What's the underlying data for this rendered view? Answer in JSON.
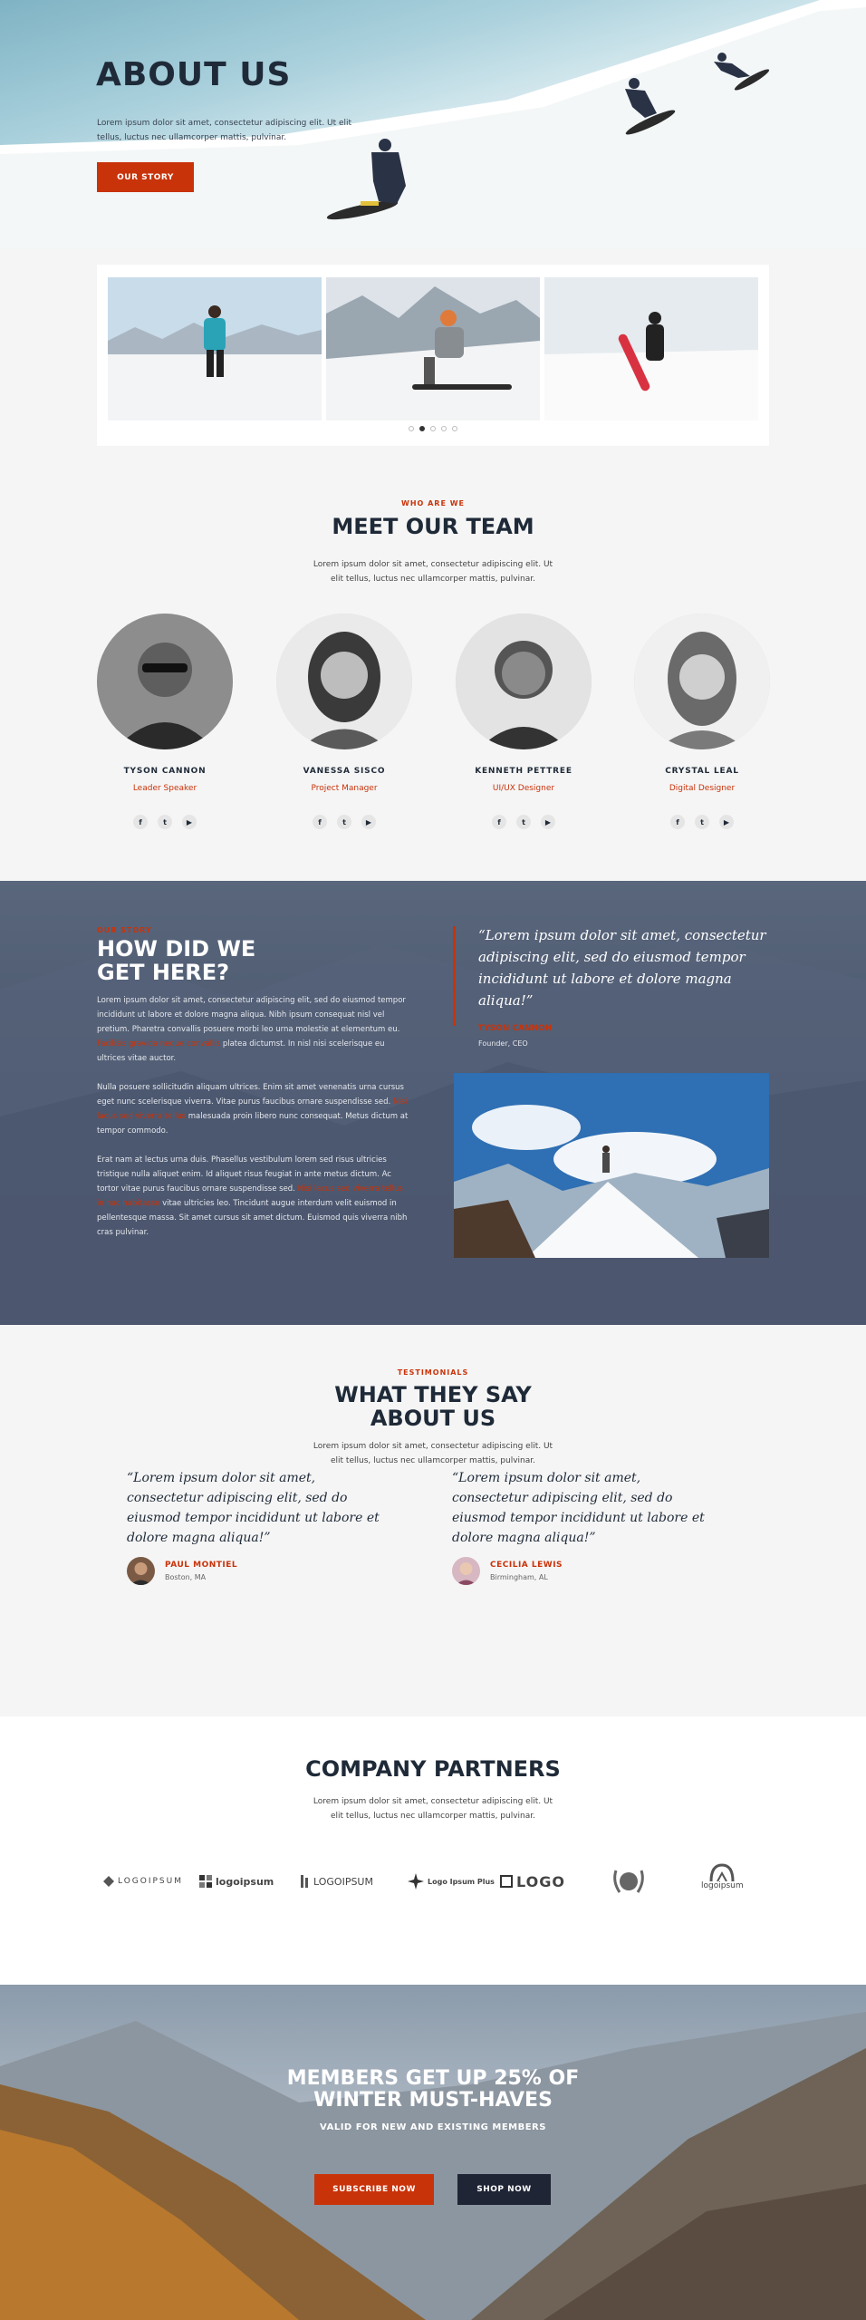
{
  "hero": {
    "title": "ABOUT US",
    "text": "Lorem ipsum dolor sit amet, consectetur adipiscing elit. Ut elit tellus, luctus nec ullamcorper mattis, pulvinar.",
    "button": "OUR STORY"
  },
  "carousel": {
    "slides": [
      "hiker-on-snow",
      "snowboarder-sitting",
      "snowboarder-with-board"
    ],
    "dots": 5,
    "active_dot": 2
  },
  "team": {
    "eyebrow": "WHO ARE WE",
    "title": "MEET OUR TEAM",
    "text": "Lorem ipsum dolor sit amet, consectetur adipiscing elit. Ut elit tellus, luctus nec ullamcorper mattis, pulvinar.",
    "members": [
      {
        "name": "TYSON CANNON",
        "role": "Leader Speaker"
      },
      {
        "name": "VANESSA SISCO",
        "role": "Project Manager"
      },
      {
        "name": "KENNETH PETTREE",
        "role": "UI/UX Designer"
      },
      {
        "name": "CRYSTAL LEAL",
        "role": "Digital Designer"
      }
    ],
    "social_icons": [
      "facebook-icon",
      "twitter-icon",
      "youtube-icon"
    ]
  },
  "history": {
    "eyebrow": "OUR STORY",
    "title": "HOW DID WE GET HERE?",
    "p1": "Lorem ipsum dolor sit amet, consectetur adipiscing elit, sed do eiusmod tempor incididunt ut labore et dolore magna aliqua. Nibh ipsum consequat nisl vel pretium. Pharetra convallis posuere morbi leo urna molestie at elementum eu.",
    "p1_link": "Facilisis gravida neque convallis",
    "p1_tail": "platea dictumst. In nisl nisi scelerisque eu ultrices vitae auctor.",
    "p2": "Nulla posuere sollicitudin aliquam ultrices. Enim sit amet venenatis urna cursus eget nunc scelerisque viverra. Vitae purus faucibus ornare suspendisse sed.",
    "p2_link": "Nisi lacus sed viverra tellus",
    "p2_tail": "malesuada proin libero nunc consequat. Metus dictum at tempor commodo.",
    "p3": "Erat nam at lectus urna duis. Phasellus vestibulum lorem sed risus ultricies tristique nulla aliquet enim. Id aliquet risus feugiat in ante metus dictum. Ac tortor vitae purus faucibus ornare suspendisse sed.",
    "p3_link": "Nisi lacus sed viverra tellus in",
    "p3_link2": "hac habitasse",
    "p3_tail": "vitae ultricies leo. Tincidunt augue interdum velit euismod in pellentesque massa. Sit amet cursus sit amet dictum. Euismod quis viverra nibh cras pulvinar.",
    "quote": "“Lorem ipsum dolor sit amet, consectetur adipiscing elit, sed do eiusmod tempor incididunt ut labore et dolore magna aliqua!”",
    "quote_name": "TYSON CANNON",
    "quote_role": "Founder, CEO"
  },
  "testimonials": {
    "eyebrow": "TESTIMONIALS",
    "title_line1": "WHAT THEY SAY",
    "title_line2": "ABOUT US",
    "text": "Lorem ipsum dolor sit amet, consectetur adipiscing elit. Ut elit tellus, luctus nec ullamcorper mattis, pulvinar.",
    "items": [
      {
        "quote": "“Lorem ipsum dolor sit amet, consectetur adipiscing elit, sed do eiusmod tempor incididunt ut labore et dolore magna aliqua!”",
        "name": "PAUL MONTIEL",
        "location": "Boston, MA"
      },
      {
        "quote": "“Lorem ipsum dolor sit amet, consectetur adipiscing elit, sed do eiusmod tempor incididunt ut labore et dolore magna aliqua!”",
        "name": "CECILIA LEWIS",
        "location": "Birmingham, AL"
      }
    ]
  },
  "partners": {
    "title": "COMPANY PARTNERS",
    "text": "Lorem ipsum dolor sit amet, consectetur adipiscing elit. Ut elit tellus, luctus nec ullamcorper mattis, pulvinar.",
    "logos": [
      "LOGOIPSUM",
      "logoipsum",
      "LOGOIPSUM",
      "Logo Ipsum Plus",
      "LOGO",
      "laurel-logo",
      "logoipsum"
    ]
  },
  "cta": {
    "title_line1": "MEMBERS GET UP 25% OF",
    "title_line2": "WINTER MUST-HAVES",
    "sub": "VALID FOR NEW AND EXISTING MEMBERS",
    "primary": "SUBSCRIBE NOW",
    "secondary": "SHOP NOW"
  },
  "colors": {
    "accent": "#c9330a",
    "dark": "#1f2a38",
    "history_bg": "#4d5a70"
  }
}
